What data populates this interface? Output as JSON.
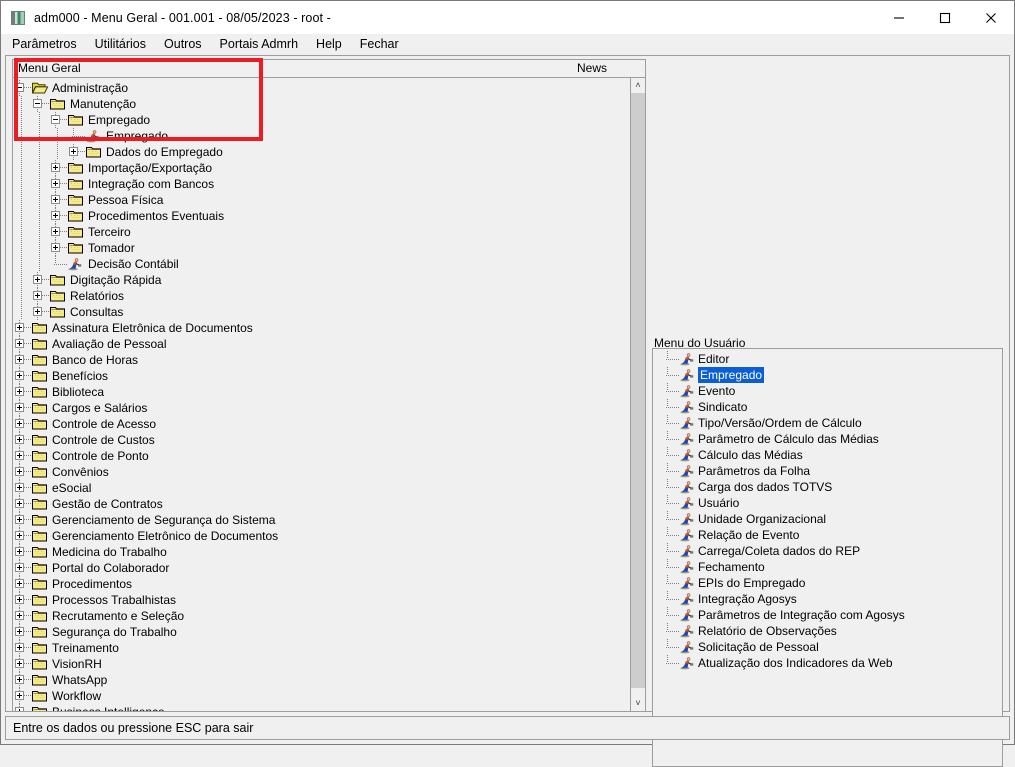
{
  "window": {
    "title": "adm000 - Menu Geral - 001.001 - 08/05/2023 - root -",
    "icon": "app-icon",
    "minimize_label": "—",
    "maximize_label": "□",
    "close_label": "✕"
  },
  "menubar": {
    "items": [
      {
        "label": "Parâmetros"
      },
      {
        "label": "Utilitários"
      },
      {
        "label": "Outros"
      },
      {
        "label": "Portais Admrh"
      },
      {
        "label": "Help"
      },
      {
        "label": "Fechar"
      }
    ]
  },
  "tree_panel": {
    "header": "Menu Geral",
    "scrollbar": {
      "up": "˄",
      "down": "˅"
    },
    "nodes": [
      {
        "label": "Administração",
        "depth": 0,
        "type": "folder-open",
        "state": "expanded"
      },
      {
        "label": "Manutenção",
        "depth": 1,
        "type": "folder",
        "state": "expanded"
      },
      {
        "label": "Empregado",
        "depth": 2,
        "type": "folder",
        "state": "expanded"
      },
      {
        "label": "Empregado",
        "depth": 3,
        "type": "program",
        "state": "leaf"
      },
      {
        "label": "Dados do Empregado",
        "depth": 3,
        "type": "folder",
        "state": "collapsed"
      },
      {
        "label": "Importação/Exportação",
        "depth": 2,
        "type": "folder",
        "state": "collapsed"
      },
      {
        "label": "Integração com Bancos",
        "depth": 2,
        "type": "folder",
        "state": "collapsed"
      },
      {
        "label": "Pessoa Física",
        "depth": 2,
        "type": "folder",
        "state": "collapsed"
      },
      {
        "label": "Procedimentos Eventuais",
        "depth": 2,
        "type": "folder",
        "state": "collapsed"
      },
      {
        "label": "Terceiro",
        "depth": 2,
        "type": "folder",
        "state": "collapsed"
      },
      {
        "label": "Tomador",
        "depth": 2,
        "type": "folder",
        "state": "collapsed"
      },
      {
        "label": "Decisão Contábil",
        "depth": 2,
        "type": "program",
        "state": "leaf"
      },
      {
        "label": "Digitação Rápida",
        "depth": 1,
        "type": "folder",
        "state": "collapsed"
      },
      {
        "label": "Relatórios",
        "depth": 1,
        "type": "folder",
        "state": "collapsed"
      },
      {
        "label": "Consultas",
        "depth": 1,
        "type": "folder",
        "state": "collapsed"
      },
      {
        "label": "Assinatura Eletrônica de Documentos",
        "depth": 0,
        "type": "folder",
        "state": "collapsed"
      },
      {
        "label": "Avaliação de Pessoal",
        "depth": 0,
        "type": "folder",
        "state": "collapsed"
      },
      {
        "label": "Banco de Horas",
        "depth": 0,
        "type": "folder",
        "state": "collapsed"
      },
      {
        "label": "Benefícios",
        "depth": 0,
        "type": "folder",
        "state": "collapsed"
      },
      {
        "label": "Biblioteca",
        "depth": 0,
        "type": "folder",
        "state": "collapsed"
      },
      {
        "label": "Cargos e Salários",
        "depth": 0,
        "type": "folder",
        "state": "collapsed"
      },
      {
        "label": "Controle de Acesso",
        "depth": 0,
        "type": "folder",
        "state": "collapsed"
      },
      {
        "label": "Controle de Custos",
        "depth": 0,
        "type": "folder",
        "state": "collapsed"
      },
      {
        "label": "Controle de Ponto",
        "depth": 0,
        "type": "folder",
        "state": "collapsed"
      },
      {
        "label": "Convênios",
        "depth": 0,
        "type": "folder",
        "state": "collapsed"
      },
      {
        "label": "eSocial",
        "depth": 0,
        "type": "folder",
        "state": "collapsed"
      },
      {
        "label": "Gestão de Contratos",
        "depth": 0,
        "type": "folder",
        "state": "collapsed"
      },
      {
        "label": "Gerenciamento de Segurança do Sistema",
        "depth": 0,
        "type": "folder",
        "state": "collapsed"
      },
      {
        "label": "Gerenciamento Eletrônico de Documentos",
        "depth": 0,
        "type": "folder",
        "state": "collapsed"
      },
      {
        "label": "Medicina do Trabalho",
        "depth": 0,
        "type": "folder",
        "state": "collapsed"
      },
      {
        "label": "Portal do Colaborador",
        "depth": 0,
        "type": "folder",
        "state": "collapsed"
      },
      {
        "label": "Procedimentos",
        "depth": 0,
        "type": "folder",
        "state": "collapsed"
      },
      {
        "label": "Processos Trabalhistas",
        "depth": 0,
        "type": "folder",
        "state": "collapsed"
      },
      {
        "label": "Recrutamento e Seleção",
        "depth": 0,
        "type": "folder",
        "state": "collapsed"
      },
      {
        "label": "Segurança do Trabalho",
        "depth": 0,
        "type": "folder",
        "state": "collapsed"
      },
      {
        "label": "Treinamento",
        "depth": 0,
        "type": "folder",
        "state": "collapsed"
      },
      {
        "label": "VisionRH",
        "depth": 0,
        "type": "folder",
        "state": "collapsed"
      },
      {
        "label": "WhatsApp",
        "depth": 0,
        "type": "folder",
        "state": "collapsed"
      },
      {
        "label": "Workflow",
        "depth": 0,
        "type": "folder",
        "state": "collapsed"
      },
      {
        "label": "Business Intelligence",
        "depth": 0,
        "type": "folder",
        "state": "collapsed"
      }
    ]
  },
  "news": {
    "label": "News"
  },
  "user_menu": {
    "title": "Menu do Usuário",
    "selected": "Empregado",
    "items": [
      {
        "label": "Editor"
      },
      {
        "label": "Empregado"
      },
      {
        "label": "Evento"
      },
      {
        "label": "Sindicato"
      },
      {
        "label": "Tipo/Versão/Ordem de Cálculo"
      },
      {
        "label": "Parâmetro de Cálculo das Médias"
      },
      {
        "label": "Cálculo das Médias"
      },
      {
        "label": "Parâmetros da Folha"
      },
      {
        "label": "Carga dos dados TOTVS"
      },
      {
        "label": "Usuário"
      },
      {
        "label": "Unidade Organizacional"
      },
      {
        "label": "Relação de Evento"
      },
      {
        "label": "Carrega/Coleta dados do REP"
      },
      {
        "label": "Fechamento"
      },
      {
        "label": "EPIs do Empregado"
      },
      {
        "label": "Integração Agosys"
      },
      {
        "label": "Parâmetros de Integração com Agosys"
      },
      {
        "label": "Relatório de Observações"
      },
      {
        "label": "Solicitação de Pessoal"
      },
      {
        "label": "Atualização dos Indicadores da Web"
      }
    ]
  },
  "statusbar": {
    "text": "Entre os dados ou pressione ESC para sair"
  },
  "annotation": {
    "color": "#ec1c24"
  }
}
